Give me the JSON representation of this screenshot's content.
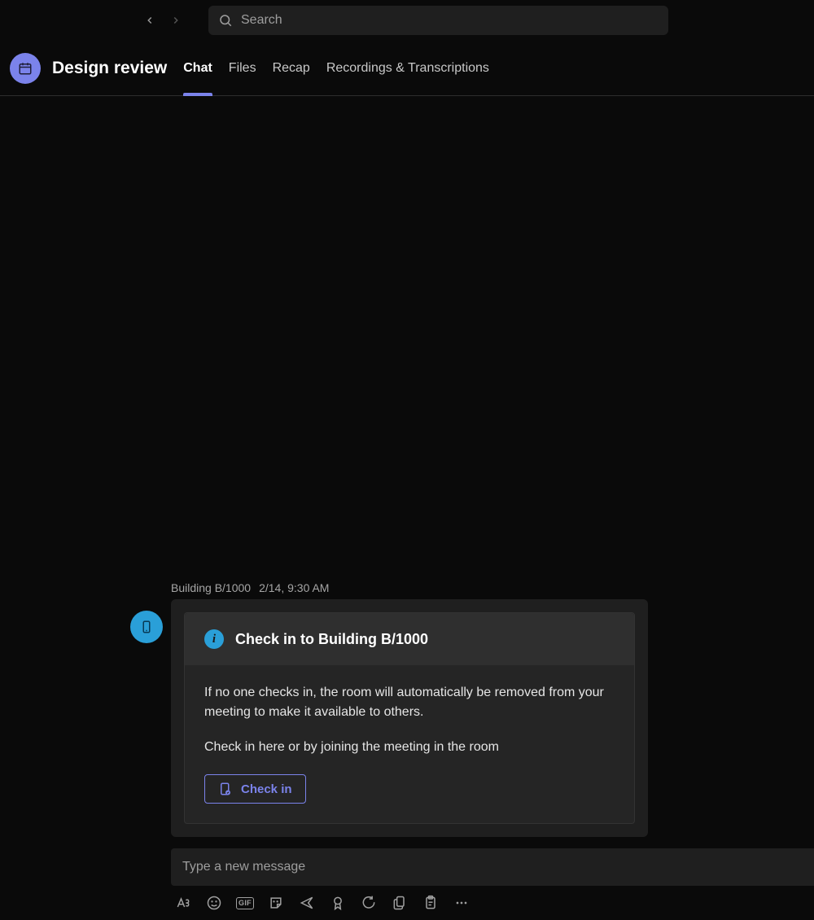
{
  "search": {
    "placeholder": "Search"
  },
  "header": {
    "title": "Design review",
    "tabs": [
      {
        "label": "Chat",
        "active": true
      },
      {
        "label": "Files"
      },
      {
        "label": "Recap"
      },
      {
        "label": "Recordings & Transcriptions"
      }
    ]
  },
  "message": {
    "sender": "Building B/1000",
    "timestamp": "2/14, 9:30 AM",
    "card": {
      "title": "Check in to Building B/1000",
      "body1": "If no one checks in, the room will automatically be removed from your meeting to make it available to others.",
      "body2": "Check in here or by joining the meeting in the room",
      "button_label": "Check in"
    }
  },
  "compose": {
    "placeholder": "Type a new message"
  },
  "toolbar_icons": {
    "gif_label": "GIF"
  }
}
